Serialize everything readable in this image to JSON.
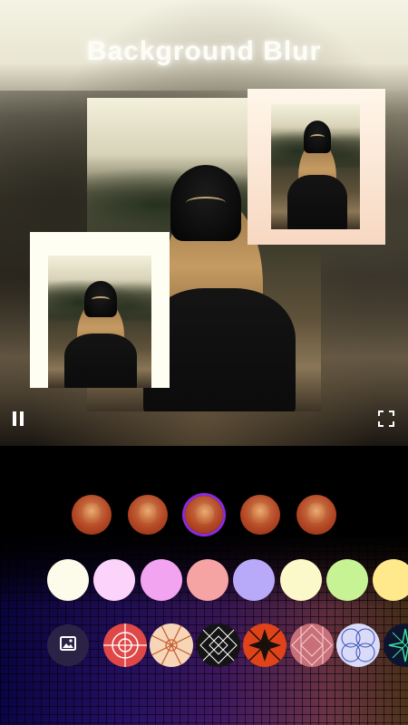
{
  "title": "Background Blur",
  "icons": {
    "play_pause": "pause-icon",
    "fullscreen": "fullscreen-icon",
    "gallery": "image-icon"
  },
  "style_thumbnails": [
    {
      "name": "style-1",
      "selected": false
    },
    {
      "name": "style-2",
      "selected": false
    },
    {
      "name": "style-3",
      "selected": true
    },
    {
      "name": "style-4",
      "selected": false
    },
    {
      "name": "style-5",
      "selected": false
    }
  ],
  "colors": [
    "#fdfbe9",
    "#fbd3fb",
    "#f3a4f1",
    "#f6a3a3",
    "#b9aaf9",
    "#fbf8c9",
    "#c7f394",
    "#ffe98c"
  ],
  "patterns": [
    {
      "name": "red-circle-pattern",
      "bg": "#e04848",
      "line": "#ffffff"
    },
    {
      "name": "peach-lattice-pattern",
      "bg": "#f6d6b6",
      "line": "#c45a32"
    },
    {
      "name": "black-white-geometric-pattern",
      "bg": "#141414",
      "line": "#ffffff"
    },
    {
      "name": "red-black-star-pattern",
      "bg": "#e0421a",
      "line": "#1a0f0a"
    },
    {
      "name": "pink-diamond-pattern",
      "bg": "#c96f7a",
      "line": "#f6d0d0"
    },
    {
      "name": "lavender-ring-pattern",
      "bg": "#d9dbf8",
      "line": "#3a4fb5"
    },
    {
      "name": "dark-green-spark-pattern",
      "bg": "#0e1430",
      "line": "#37e09a"
    }
  ]
}
